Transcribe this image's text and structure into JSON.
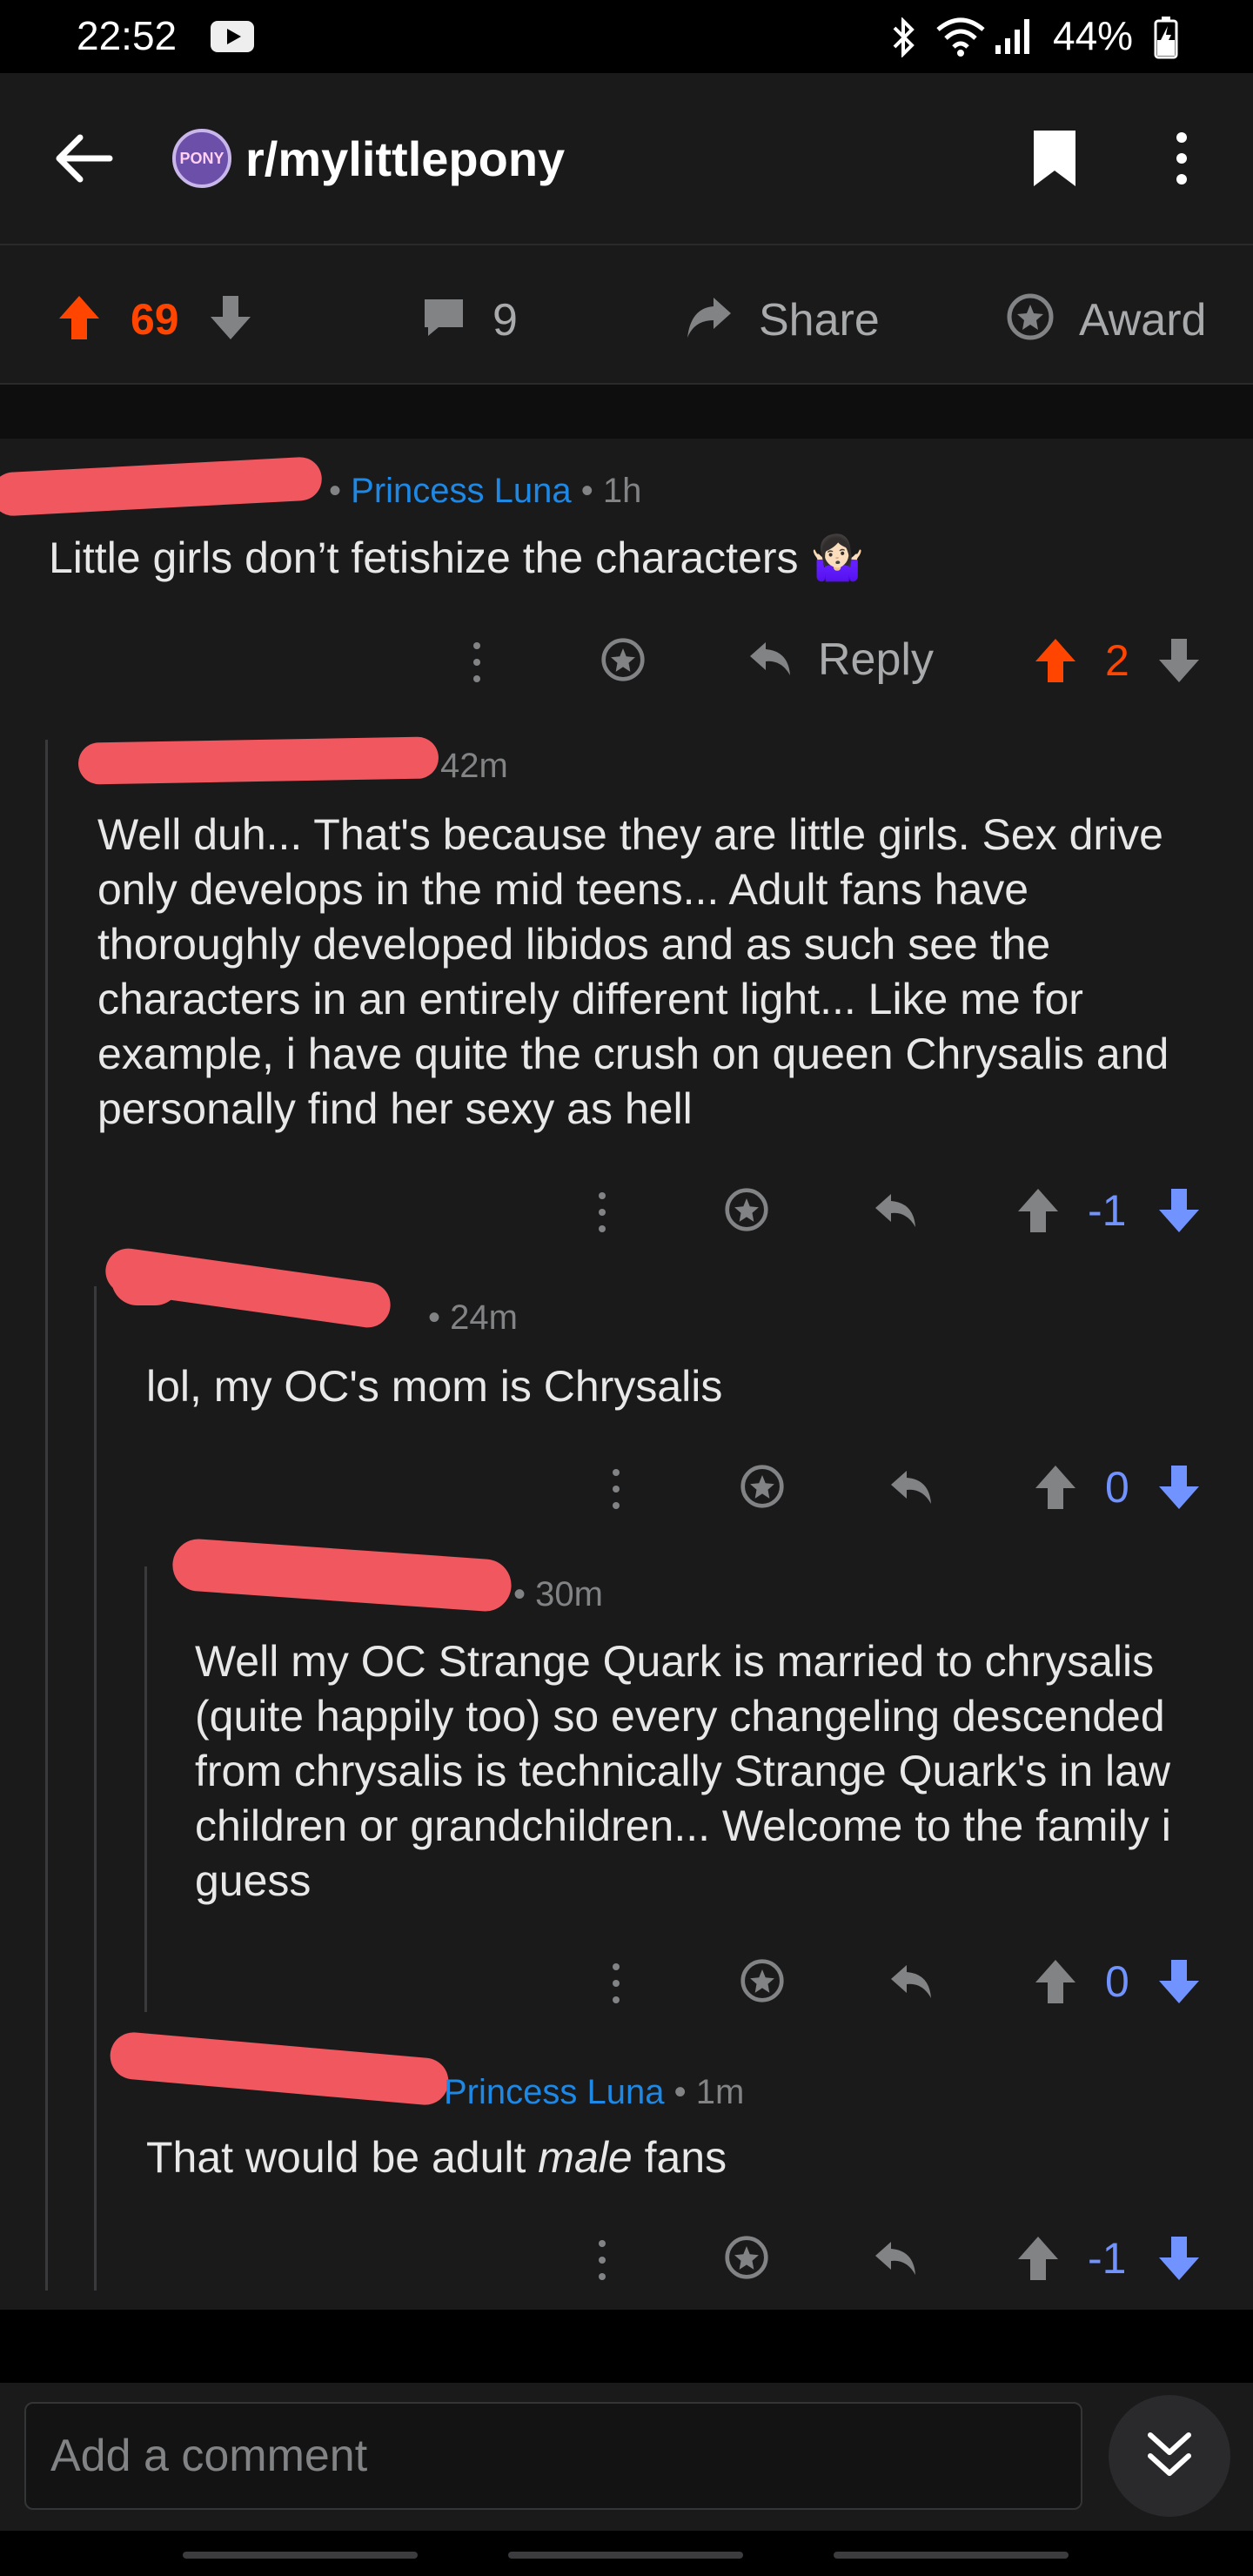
{
  "status_bar": {
    "time": "22:52",
    "battery": "44%"
  },
  "header": {
    "subreddit": "r/mylittlepony",
    "avatar_text": "PONY"
  },
  "post_actions": {
    "score": "69",
    "comments": "9",
    "share_label": "Share",
    "award_label": "Award"
  },
  "comments": [
    {
      "meta_suffix": "•",
      "flair": "Princess Luna",
      "age": "• 1h",
      "text": "Little girls don’t fetishize the characters 🤷🏻‍♀️",
      "reply_label": "Reply",
      "score": "2",
      "vote_state": "upvoted"
    },
    {
      "age": "42m",
      "text": "Well duh... That's because they are little girls. Sex drive only develops in the mid teens... Adult fans have thoroughly developed libidos and as such see the characters in an entirely different light... Like me for example, i have quite the crush on queen Chrysalis and personally find her sexy as hell",
      "score": "-1",
      "vote_state": "downvoted"
    },
    {
      "age": "• 24m",
      "text": "lol, my OC's mom is Chrysalis",
      "score": "0",
      "vote_state": "downvoted"
    },
    {
      "age": "• 30m",
      "text": "Well my OC Strange Quark is married to chrysalis (quite happily too) so every changeling descended from chrysalis is technically Strange Quark's in law children or grandchildren... Welcome to the family i guess",
      "score": "0",
      "vote_state": "downvoted"
    },
    {
      "flair": "Princess Luna",
      "age": "• 1m",
      "text_before": "That would be adult ",
      "text_italic": "male",
      "text_after": " fans",
      "score": "-1",
      "vote_state": "downvoted"
    }
  ],
  "composer": {
    "placeholder": "Add a comment"
  },
  "colors": {
    "upvote": "#ff4500",
    "downvote": "#7193ff",
    "flair": "#1e88e5",
    "redaction": "#f0575e"
  }
}
